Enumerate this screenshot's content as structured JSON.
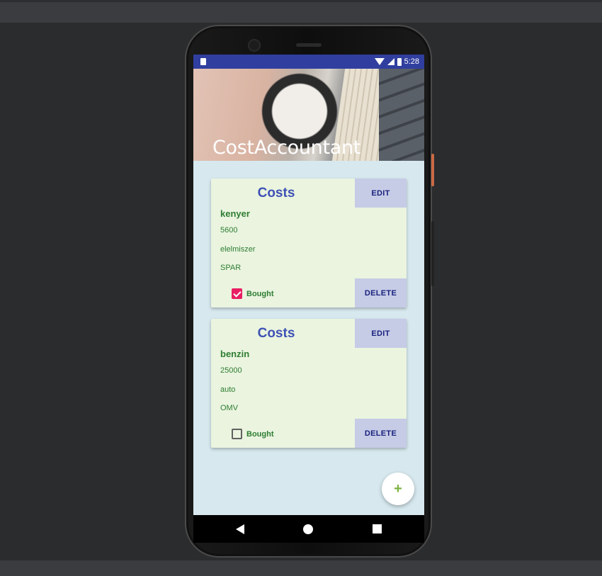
{
  "status_bar": {
    "time": "5:28"
  },
  "app": {
    "title": "CostAccountant"
  },
  "cards": [
    {
      "title": "Costs",
      "edit_label": "EDIT",
      "delete_label": "DELETE",
      "name": "kenyer",
      "amount": "5600",
      "category": "elelmiszer",
      "shop": "SPAR",
      "bought_label": "Bought",
      "bought": true
    },
    {
      "title": "Costs",
      "edit_label": "EDIT",
      "delete_label": "DELETE",
      "name": "benzin",
      "amount": "25000",
      "category": "auto",
      "shop": "OMV",
      "bought_label": "Bought",
      "bought": false
    }
  ],
  "fab": {
    "icon": "plus-icon",
    "label": "+"
  },
  "nav": {
    "back_icon": "back-icon",
    "home_icon": "home-icon",
    "recent_icon": "recent-apps-icon"
  },
  "colors": {
    "status_bar": "#303f9f",
    "card_bg": "#eaf4df",
    "button_bg": "#c6cbe6",
    "title_blue": "#3f51b5",
    "text_green": "#2e7d32",
    "checkbox_pink": "#e91e63",
    "screen_bg": "#d7e9ef"
  }
}
